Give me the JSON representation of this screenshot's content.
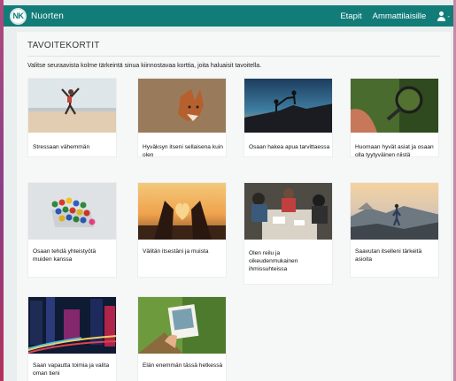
{
  "navbar": {
    "logo_text": "NK",
    "brand": "Nuorten",
    "links": [
      "Etapit",
      "Ammattilaisille"
    ],
    "user_icon": "user-icon"
  },
  "panel": {
    "title": "TAVOITEKORTIT",
    "description": "Valitse seuraavista kolme tärkeintä sinua kiinnostavaa korttia, joita haluaisit tavoitella."
  },
  "cards": [
    {
      "label": "Stressaan vähemmän"
    },
    {
      "label": "Hyväksyn itseni sellaisena kuin olen"
    },
    {
      "label": "Osaan hakea apua tarvittaessa"
    },
    {
      "label": "Huomaan hyvät asiat ja osaan olla tyytyväinen niistä"
    },
    {
      "label": "Osaan tehdä yhteistyötä muiden kanssa"
    },
    {
      "label": "Välitän itsestäni ja muista"
    },
    {
      "label": "Olen reilu ja oikeudenmukainen ihmissuhteissa"
    },
    {
      "label": "Saavutan itselleni tärkeitä asioita"
    },
    {
      "label": "Saan vapautta toimia ja valita oman tieni"
    },
    {
      "label": "Elän enemmän tässä hetkessä"
    }
  ],
  "colors": {
    "navbar": "#127c78",
    "panel": "#f6f7f7",
    "background": "#e9eeee"
  }
}
